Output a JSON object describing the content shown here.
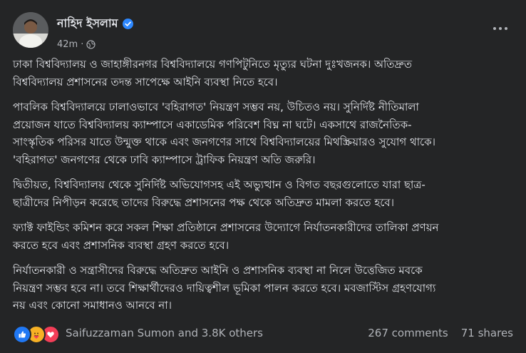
{
  "post": {
    "author": "নাহিদ ইসলাম",
    "time": "42m",
    "separator": "·",
    "paragraphs": [
      "ঢাকা বিশ্ববিদ্যালয় ও জাহাঙ্গীরনগর বিশ্ববিদ্যালয়ে গণপিটুনিতে মৃত্যুর ঘটনা দুঃখজনক। অতিদ্রুত\nবিশ্ববিদ্যালয় প্রশাসনের তদন্ত সাপেক্ষে আইনি ব্যবস্থা নিতে হবে।",
      "পাবলিক বিশ্ববিদ্যালয়ে ঢালাওভাবে 'বহিরাগত' নিয়ন্ত্রণ সম্ভব নয়, উচিতও নয়। সুনির্দিষ্ট নীতিমালা\nপ্রয়োজন যাতে বিশ্ববিদ্যালয় ক্যাম্পাসে একাডেমিক পরিবেশ বিঘ্ন না ঘটে। একসাথে রাজনৈতিক-\nসাংস্কৃতিক পরিসর যাতে উন্মুক্ত থাকে এবং জনগণের সাথে বিশ্ববিদ্যালয়ের মিথস্ক্রিয়ারও সুযোগ থাকে।\n'বহিরাগত' জনগণের থেকে ঢাবি ক্যাম্পাসে ট্রাফিক নিয়ন্ত্রণ অতি জরুরি।",
      "দ্বিতীয়ত, বিশ্ববিদ্যালয় থেকে সুনির্দিষ্ট অভিযোগসহ এই অভ্যুত্থান ও বিগত বছরগুলোতে যারা ছাত্র-\nছাত্রীদের নিপীড়ন করেছে তাদের বিরুদ্ধে প্রশাসনের পক্ষ থেকে অতিদ্রুত মামলা করতে হবে।",
      "ফ্যাক্ট ফাইন্ডিং কমিশন করে সকল শিক্ষা প্রতিষ্ঠানে প্রশাসনের উদ্যোগে নির্যাতনকারীদের তালিকা প্রণয়ন\nকরতে হবে এবং প্রশাসনিক ব্যবস্থা গ্রহণ করতে হবে।",
      "নির্যাতনকারী ও সন্ত্রাসীদের বিরুদ্ধে অতিদ্রুত আইনি ও প্রশাসনিক ব্যবস্থা না নিলে উত্তেজিত মবকে\nনিয়ন্ত্রণ সম্ভব হবে না। তবে শিক্ষার্থীদেরও দায়িত্বশীল ভূমিকা পালন করতে হবে। মবজাস্টিস গ্রহণযোগ্য\nনয় এবং কোনো সমাধানও আনবে না।"
    ]
  },
  "engagement": {
    "reactors": "Saifuzzaman Sumon and 3.8K others",
    "comments": "267 comments",
    "shares": "71 shares"
  },
  "icons": {
    "verified": "verified-badge-icon",
    "globe": "globe-icon",
    "more": "more-horizontal-icon",
    "reactions": [
      "like-icon",
      "care-icon",
      "love-icon"
    ]
  },
  "colors": {
    "background": "#242526",
    "verified": "#2d88ff",
    "like": "#2078f4",
    "love": "#f33e58",
    "care": "#f7b125"
  }
}
